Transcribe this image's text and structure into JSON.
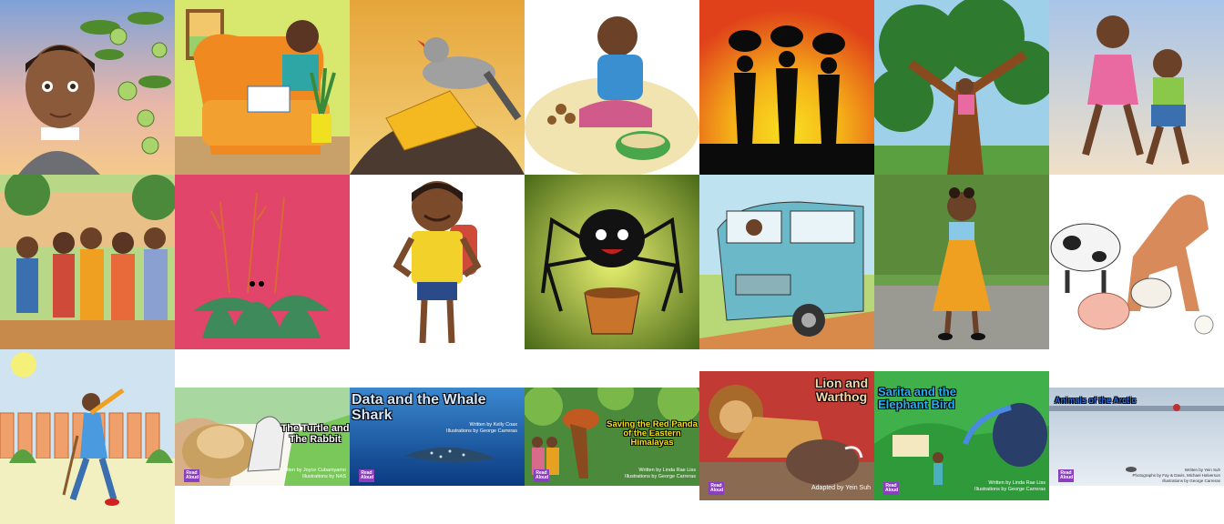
{
  "grid": {
    "tiles": [
      {
        "name": "girl-orange-tree-illustration"
      },
      {
        "name": "boy-reading-armchair-illustration"
      },
      {
        "name": "bird-honeycomb-illustration"
      },
      {
        "name": "girl-cooking-nuts-illustration"
      },
      {
        "name": "women-silhouette-sunset-illustration"
      },
      {
        "name": "girl-in-tree-illustration"
      },
      {
        "name": "girls-dancing-illustration"
      },
      {
        "name": "village-crowd-illustration"
      },
      {
        "name": "leopard-in-bushes-illustration"
      },
      {
        "name": "smiling-boy-backpack-illustration"
      },
      {
        "name": "spider-on-pot-illustration"
      },
      {
        "name": "minibus-taxi-illustration"
      },
      {
        "name": "girl-orange-dress-illustration"
      },
      {
        "name": "farm-animals-illustration"
      },
      {
        "name": "gardener-fence-illustration"
      }
    ]
  },
  "covers": [
    {
      "title": "The Turtle and The Rabbit",
      "byline_1": "Written by Joyce Cubamyamo",
      "byline_2": "Illustrations by NAS",
      "badge": "Read Aloud"
    },
    {
      "title": "Data and the Whale Shark",
      "byline_1": "Written by Kelly Coax",
      "byline_2": "Illustrations by George Carreras",
      "badge": "Read Aloud"
    },
    {
      "title": "Saving the Red Panda of the Eastern Himalayas",
      "byline_1": "Written by Linda Rae Liss",
      "byline_2": "Illustrations by George Carreras",
      "badge": "Read Aloud"
    },
    {
      "title": "Lion and Warthog",
      "byline_1": "Adapted by Yein Suh",
      "byline_2": "",
      "badge": "Read Aloud"
    },
    {
      "title": "Sarita and the Elephant Bird",
      "byline_1": "Written by Linda Rae Liss",
      "byline_2": "Illustrations by George Carreras",
      "badge": "Read Aloud"
    },
    {
      "title": "Animals of the Arctic",
      "byline_1": "Written by Yein Suh",
      "byline_2": "Photographs by Fay & Davis, Michael Halverson",
      "byline_3": "Illustrations by George Carreras",
      "badge": "Read Aloud"
    }
  ]
}
